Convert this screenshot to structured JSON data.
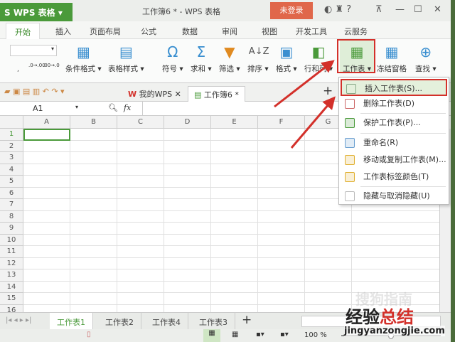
{
  "titlebar": {
    "app": "S WPS 表格",
    "title": "工作簿6 * - WPS 表格",
    "login": "未登录",
    "controls": [
      "—",
      "☐",
      "✕"
    ]
  },
  "menu_tabs": [
    "开始",
    "插入",
    "页面布局",
    "公式",
    "数据",
    "审阅",
    "视图",
    "开发工具",
    "云服务"
  ],
  "ribbon": {
    "buttons": [
      "条件格式 ▾",
      "表格样式 ▾",
      "符号 ▾",
      "求和 ▾",
      "筛选 ▾",
      "排序 ▾",
      "格式 ▾",
      "行和列 ▾",
      "工作表 ▾",
      "冻结窗格",
      "查找 ▾"
    ],
    "num_fmt": [
      ",",
      ".0→.00",
      ".00→.0"
    ]
  },
  "doc_tabs": [
    "我的WPS",
    "工作簿6 *"
  ],
  "formula": {
    "cell_ref": "A1",
    "fx": "fx"
  },
  "columns": [
    "A",
    "B",
    "C",
    "D",
    "E",
    "F",
    "G"
  ],
  "rows": [
    "1",
    "2",
    "3",
    "4",
    "5",
    "6",
    "7",
    "8",
    "9",
    "10",
    "11",
    "12",
    "13",
    "14",
    "15",
    "16"
  ],
  "context_menu": [
    "插入工作表(S)...",
    "删除工作表(D)",
    "保护工作表(P)...",
    "重命名(R)",
    "移动或复制工作表(M)...",
    "工作表标签颜色(T)",
    "隐藏与取消隐藏(U)"
  ],
  "sheet_tabs": [
    "工作表1",
    "工作表2",
    "工作表4",
    "工作表3"
  ],
  "status": {
    "zoom": "100 %"
  },
  "watermark": {
    "line1": "经验总结",
    "line2": "jingyanzongjie.com",
    "faint": "搜狗指南"
  },
  "colors": {
    "accent": "#4a9a3a",
    "highlight": "#d3302a"
  }
}
